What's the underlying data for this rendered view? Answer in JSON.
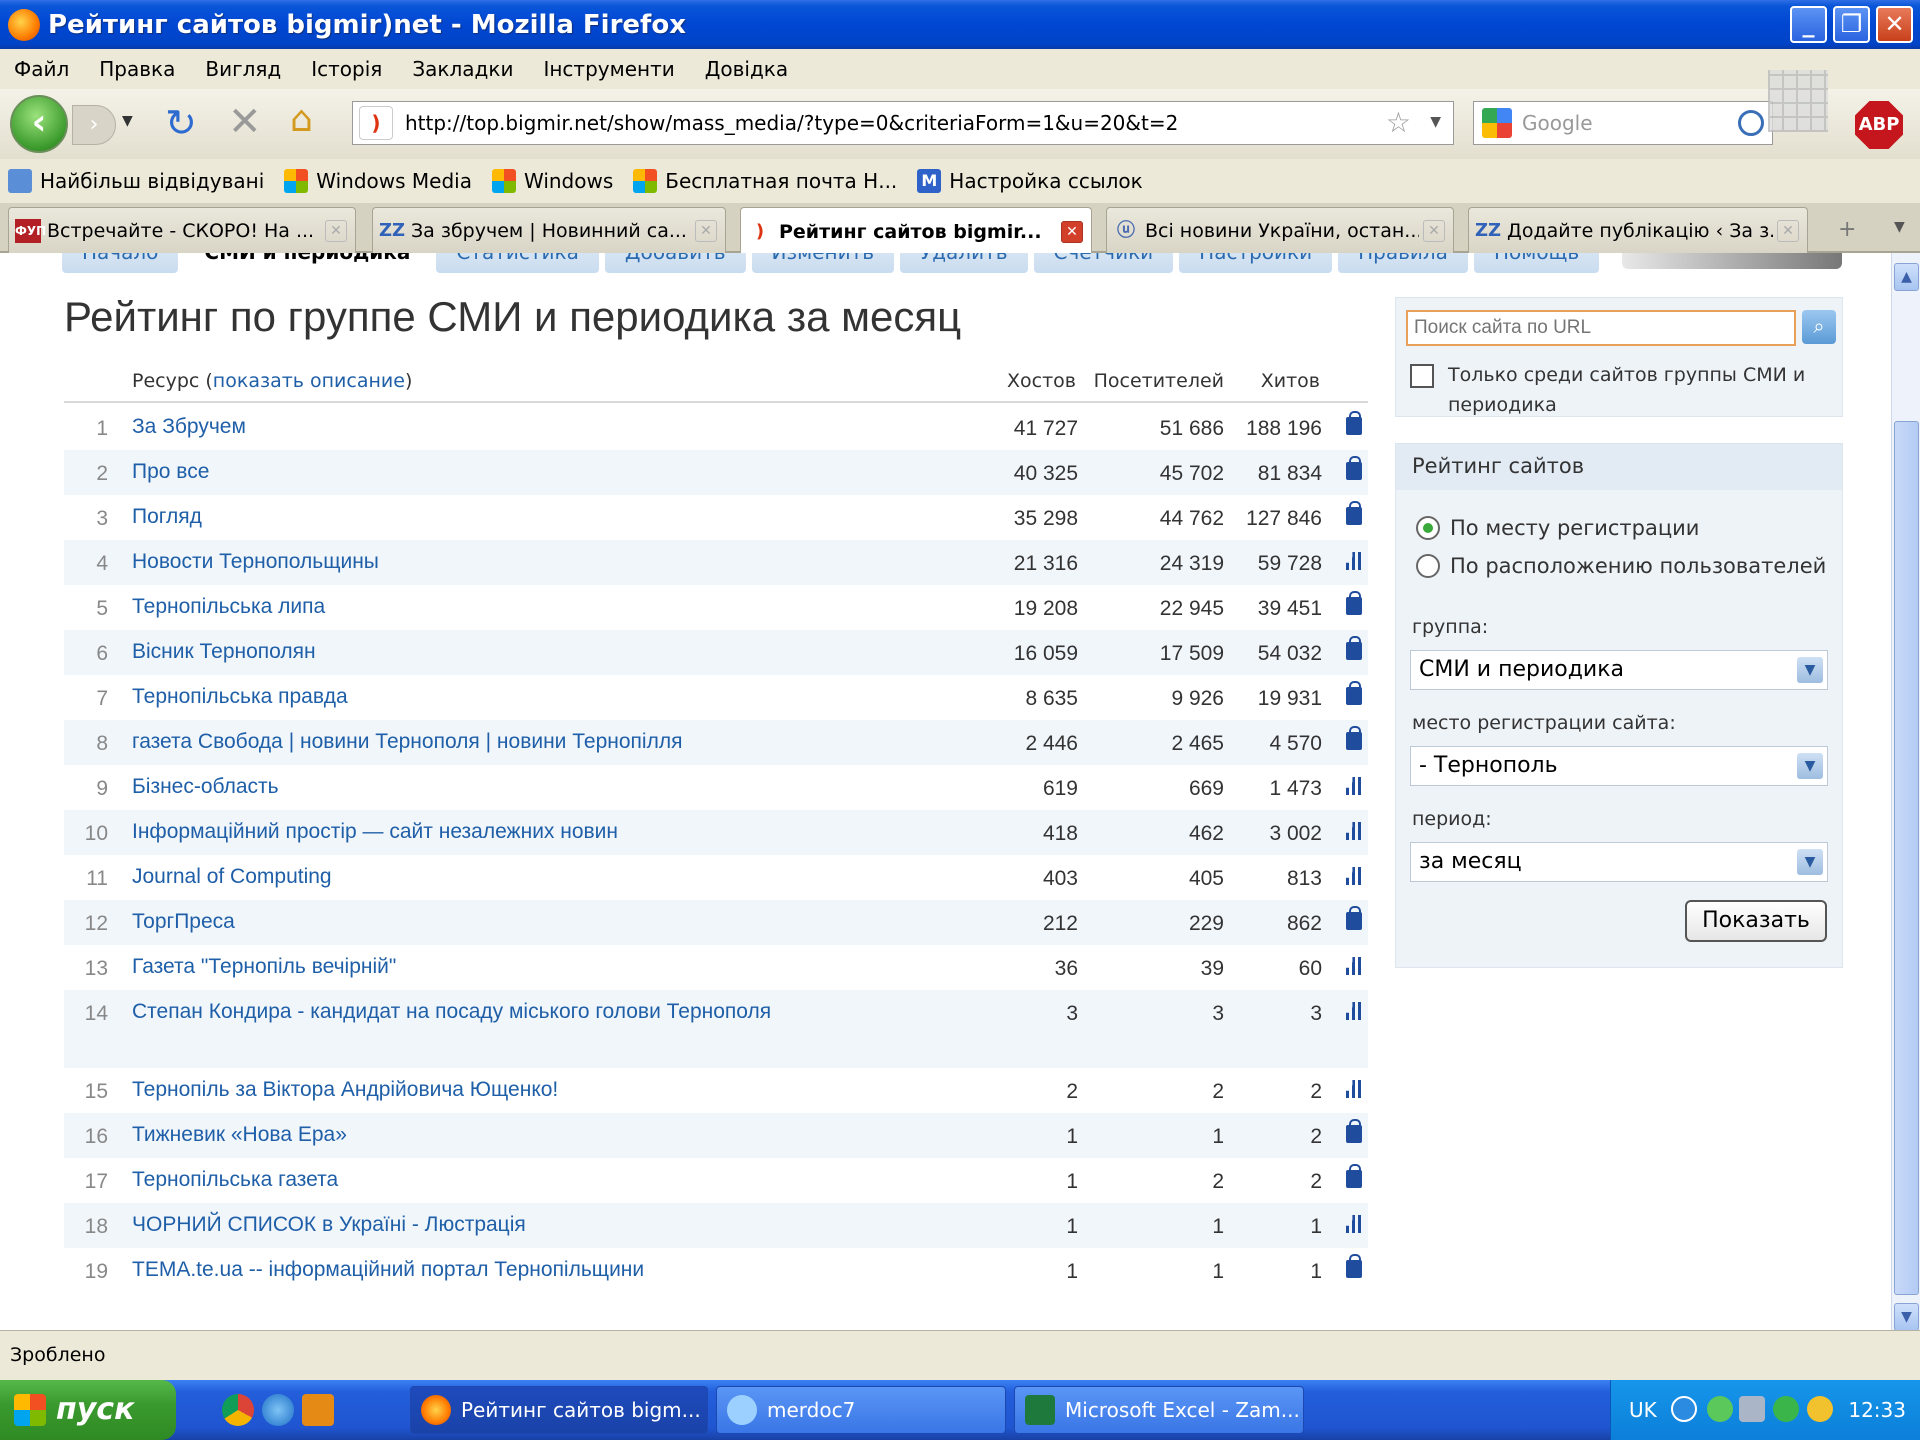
{
  "window": {
    "title": "Рейтинг сайтов bigmir)net - Mozilla Firefox"
  },
  "menu": [
    "Файл",
    "Правка",
    "Вигляд",
    "Історія",
    "Закладки",
    "Інструменти",
    "Довідка"
  ],
  "toolbar": {
    "url": "http://top.bigmir.net/show/mass_media/?type=0&criteriaForm=1&u=20&t=2",
    "search_placeholder": "Google",
    "abp": "ABP"
  },
  "bookmarks": [
    "Найбільш відвідувані",
    "Windows Media",
    "Windows",
    "Бесплатная почта Н...",
    "Настройка ссылок"
  ],
  "tabs": [
    {
      "label": "Встречайте - СКОРО! На ...",
      "icon": "ФУП"
    },
    {
      "label": "За збручем | Новинний са...",
      "icon": "ZZ"
    },
    {
      "label": "Рейтинг сайтов bigmir...",
      "icon": ")"
    },
    {
      "label": "Всі новини України, остан...",
      "icon": "ⓤ"
    },
    {
      "label": "Додайте публікацію ‹ За з...",
      "icon": "ZZ"
    }
  ],
  "subnav": [
    "Начало",
    "СМИ и периодика",
    "Статистика",
    "Добавить",
    "Изменить",
    "Удалить",
    "Счетчики",
    "Настройки",
    "Правила",
    "Помощь"
  ],
  "page": {
    "title": "Рейтинг по группе СМИ и периодика за месяц"
  },
  "table": {
    "col_resource": "Ресурс (",
    "show_desc": "показать описание",
    "col_resource_close": ")",
    "col_hosts": "Хостов",
    "col_visitors": "Посетителей",
    "col_hits": "Хитов",
    "rows": [
      {
        "n": "1",
        "name": "За Збручем",
        "hosts": "41 727",
        "visitors": "51 686",
        "hits": "188 196",
        "icon": "lock"
      },
      {
        "n": "2",
        "name": "Про все",
        "hosts": "40 325",
        "visitors": "45 702",
        "hits": "81 834",
        "icon": "lock"
      },
      {
        "n": "3",
        "name": "Погляд",
        "hosts": "35 298",
        "visitors": "44 762",
        "hits": "127 846",
        "icon": "lock"
      },
      {
        "n": "4",
        "name": "Новости Тернопольщины",
        "hosts": "21 316",
        "visitors": "24 319",
        "hits": "59 728",
        "icon": "bars"
      },
      {
        "n": "5",
        "name": "Тернопільська липа",
        "hosts": "19 208",
        "visitors": "22 945",
        "hits": "39 451",
        "icon": "lock"
      },
      {
        "n": "6",
        "name": "Вісник Тернополян",
        "hosts": "16 059",
        "visitors": "17 509",
        "hits": "54 032",
        "icon": "lock"
      },
      {
        "n": "7",
        "name": "Тернопільська правда",
        "hosts": "8 635",
        "visitors": "9 926",
        "hits": "19 931",
        "icon": "lock"
      },
      {
        "n": "8",
        "name": "газета Свобода | новини Тернополя | новини Тернопілля",
        "hosts": "2 446",
        "visitors": "2 465",
        "hits": "4 570",
        "icon": "lock"
      },
      {
        "n": "9",
        "name": "Бізнес-область",
        "hosts": "619",
        "visitors": "669",
        "hits": "1 473",
        "icon": "bars"
      },
      {
        "n": "10",
        "name": "Інформаційний простір — сайт незалежних новин",
        "hosts": "418",
        "visitors": "462",
        "hits": "3 002",
        "icon": "bars"
      },
      {
        "n": "11",
        "name": "Journal of Computing",
        "hosts": "403",
        "visitors": "405",
        "hits": "813",
        "icon": "bars"
      },
      {
        "n": "12",
        "name": "ТоргПреса",
        "hosts": "212",
        "visitors": "229",
        "hits": "862",
        "icon": "lock"
      },
      {
        "n": "13",
        "name": "Газета \"Тернопіль вечірній\"",
        "hosts": "36",
        "visitors": "39",
        "hits": "60",
        "icon": "bars"
      },
      {
        "n": "14",
        "name": "Степан Кондира - кандидат на посаду міського голови Тернополя",
        "hosts": "3",
        "visitors": "3",
        "hits": "3",
        "icon": "bars",
        "tall": true
      },
      {
        "n": "15",
        "name": "Тернопіль за Віктора Андрійовича Ющенко!",
        "hosts": "2",
        "visitors": "2",
        "hits": "2",
        "icon": "bars"
      },
      {
        "n": "16",
        "name": "Тижневик «Нова Ера»",
        "hosts": "1",
        "visitors": "1",
        "hits": "2",
        "icon": "lock"
      },
      {
        "n": "17",
        "name": "Тернопільська газета",
        "hosts": "1",
        "visitors": "2",
        "hits": "2",
        "icon": "lock"
      },
      {
        "n": "18",
        "name": "ЧОРНИЙ СПИСОК в Україні - Люстрація",
        "hosts": "1",
        "visitors": "1",
        "hits": "1",
        "icon": "bars"
      },
      {
        "n": "19",
        "name": "TEMA.te.ua -- інформаційний портал Тернопільщини",
        "hosts": "1",
        "visitors": "1",
        "hits": "1",
        "icon": "lock"
      }
    ]
  },
  "sidebar": {
    "search_placeholder": "Поиск сайта по URL",
    "only_group": "Только среди сайтов группы СМИ и периодика",
    "rating_title": "Рейтинг сайтов",
    "radio_reg": "По месту регистрации",
    "radio_users": "По расположению пользователей",
    "group_label": "группа:",
    "group_value": "СМИ и периодика",
    "place_label": "место регистрации сайта:",
    "place_value": "- Тернополь",
    "period_label": "период:",
    "period_value": "за месяц",
    "show_button": "Показать"
  },
  "status": "Зроблено",
  "taskbar": {
    "start": "пуск",
    "items": [
      "Рейтинг сайтов bigm...",
      "merdoc7",
      "Microsoft Excel - Zam..."
    ],
    "lang": "UK",
    "clock": "12:33"
  }
}
